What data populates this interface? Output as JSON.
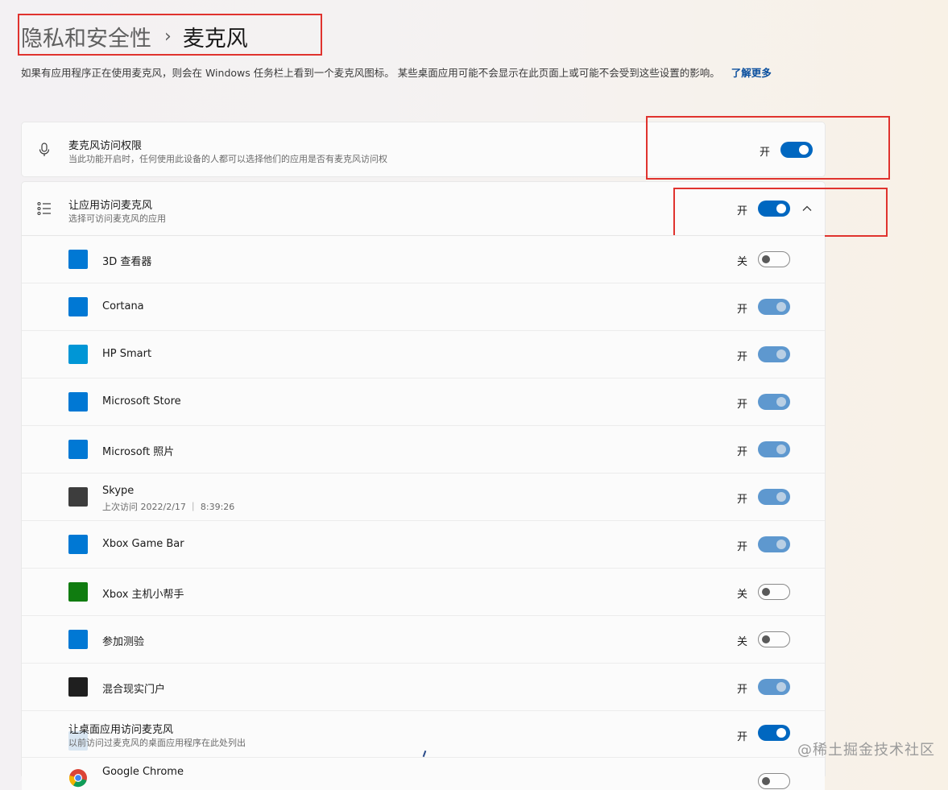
{
  "breadcrumb": {
    "parent": "隐私和安全性",
    "separator": "›",
    "current": "麦克风"
  },
  "description": {
    "text": "如果有应用程序正在使用麦克风，则会在 Windows 任务栏上看到一个麦克风图标。 某些桌面应用可能不会显示在此页面上或可能不会受到这些设置的影响。",
    "link": "了解更多"
  },
  "mic_access": {
    "title": "麦克风访问权限",
    "subtitle": "当此功能开启时，任何使用此设备的人都可以选择他们的应用是否有麦克风访问权",
    "state": "开",
    "on": true,
    "icon": "microphone-icon"
  },
  "app_access": {
    "title": "让应用访问麦克风",
    "subtitle": "选择可访问麦克风的应用",
    "state": "开",
    "on": true,
    "expanded": true,
    "icon": "list-icon"
  },
  "apps": [
    {
      "name": "3D 查看器",
      "state": "关",
      "on": false,
      "color": "#0078d4"
    },
    {
      "name": "Cortana",
      "state": "开",
      "on": true,
      "color": "#0078d4"
    },
    {
      "name": "HP Smart",
      "state": "开",
      "on": true,
      "color": "#0096d6"
    },
    {
      "name": "Microsoft Store",
      "state": "开",
      "on": true,
      "color": "#0078d4"
    },
    {
      "name": "Microsoft 照片",
      "state": "开",
      "on": true,
      "color": "#0078d4"
    },
    {
      "name": "Skype",
      "sub": "上次访问 2022/2/17 ｜ 8:39:26",
      "state": "开",
      "on": true,
      "color": "#3d3d3d"
    },
    {
      "name": "Xbox Game Bar",
      "state": "开",
      "on": true,
      "color": "#0078d4"
    },
    {
      "name": "Xbox 主机小帮手",
      "state": "关",
      "on": false,
      "color": "#107c10"
    },
    {
      "name": "参加测验",
      "state": "关",
      "on": false,
      "color": "#0078d4"
    },
    {
      "name": "混合现实门户",
      "state": "开",
      "on": true,
      "color": "#1f1f1f"
    }
  ],
  "desktop_access": {
    "title": "让桌面应用访问麦克风",
    "subtitle": "以前访问过麦克风的桌面应用程序在此处列出",
    "state": "开",
    "on": true
  },
  "desktop_apps": [
    {
      "name": "Google Chrome"
    }
  ],
  "watermark": "@稀土掘金技术社区"
}
